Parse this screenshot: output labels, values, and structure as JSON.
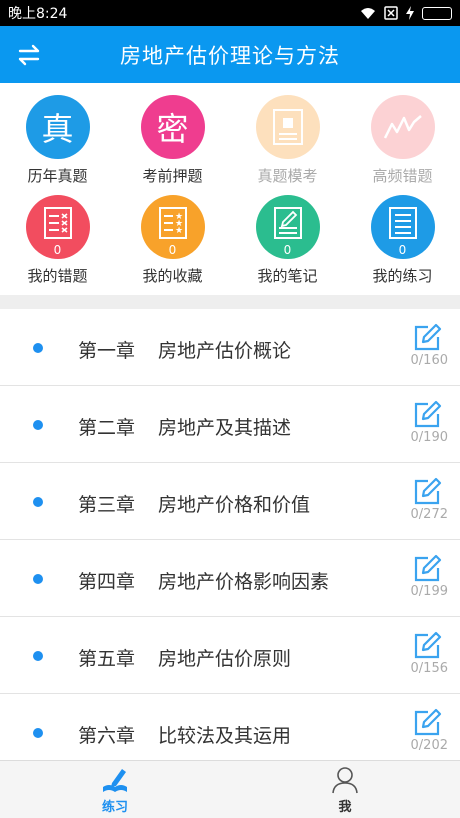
{
  "status_bar": {
    "time": "晚上8:24"
  },
  "header": {
    "title": "房地产估价理论与方法"
  },
  "grid": [
    {
      "label": "历年真题",
      "glyph": "真",
      "color": "#1e9be6",
      "count": "",
      "icon": "zhen-char-icon",
      "dim": false
    },
    {
      "label": "考前押题",
      "glyph": "密",
      "color": "#ef3d8f",
      "count": "",
      "icon": "mi-char-icon",
      "dim": false
    },
    {
      "label": "真题模考",
      "glyph": "",
      "color": "#fde0bd",
      "count": "",
      "icon": "exam-paper-icon",
      "dim": true
    },
    {
      "label": "高频错题",
      "glyph": "",
      "color": "#fcd2d4",
      "count": "",
      "icon": "trend-chart-icon",
      "dim": true
    },
    {
      "label": "我的错题",
      "glyph": "",
      "color": "#f24d5f",
      "count": "0",
      "icon": "wrong-list-icon",
      "dim": false
    },
    {
      "label": "我的收藏",
      "glyph": "",
      "color": "#f8a22a",
      "count": "0",
      "icon": "star-list-icon",
      "dim": false
    },
    {
      "label": "我的笔记",
      "glyph": "",
      "color": "#2bbd8f",
      "count": "0",
      "icon": "note-pen-icon",
      "dim": false
    },
    {
      "label": "我的练习",
      "glyph": "",
      "color": "#1e9be6",
      "count": "0",
      "icon": "practice-doc-icon",
      "dim": false
    }
  ],
  "chapters": [
    {
      "chapter": "第一章",
      "name": "房地产估价概论",
      "progress": "0/160"
    },
    {
      "chapter": "第二章",
      "name": "房地产及其描述",
      "progress": "0/190"
    },
    {
      "chapter": "第三章",
      "name": "房地产价格和价值",
      "progress": "0/272"
    },
    {
      "chapter": "第四章",
      "name": "房地产价格影响因素",
      "progress": "0/199"
    },
    {
      "chapter": "第五章",
      "name": "房地产估价原则",
      "progress": "0/156"
    },
    {
      "chapter": "第六章",
      "name": "比较法及其运用",
      "progress": "0/202"
    }
  ],
  "tabs": [
    {
      "label": "练习",
      "color": "#1e90f0",
      "icon": "practice-tab-icon"
    },
    {
      "label": "我",
      "color": "#333333",
      "icon": "person-icon"
    }
  ]
}
